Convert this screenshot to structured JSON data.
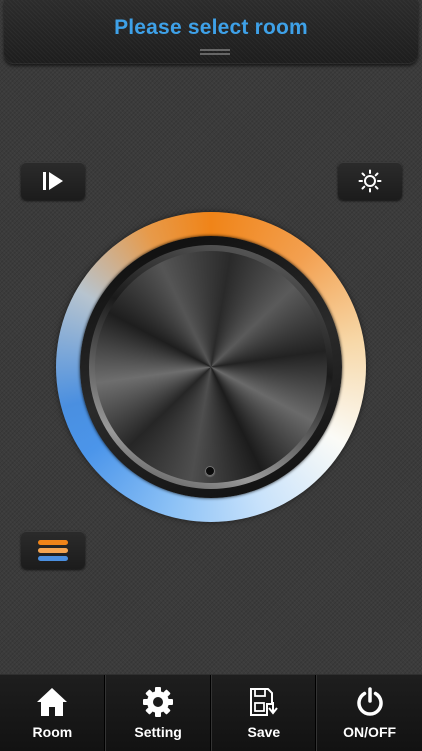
{
  "header": {
    "title": "Please select room"
  },
  "controls": {
    "play_icon": "play-icon",
    "brightness_icon": "sun-icon",
    "menu_icon": "menu-bars-icon"
  },
  "colors": {
    "title": "#3ea1e8",
    "warm": "#f08418",
    "cool": "#4a8fe0"
  },
  "tabs": [
    {
      "label": "Room",
      "icon": "home-icon"
    },
    {
      "label": "Setting",
      "icon": "gear-icon"
    },
    {
      "label": "Save",
      "icon": "save-icon"
    },
    {
      "label": "ON/OFF",
      "icon": "power-icon"
    }
  ]
}
